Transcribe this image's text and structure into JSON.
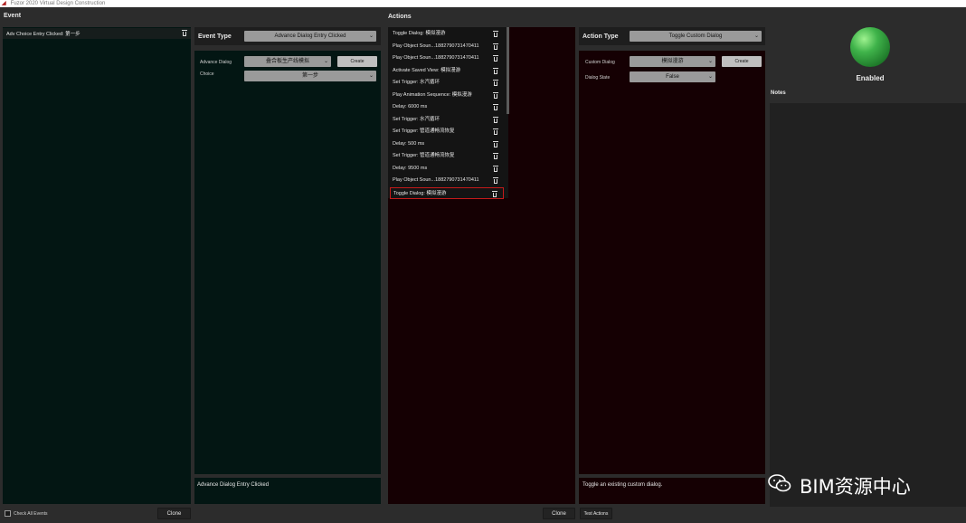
{
  "window": {
    "title": "Fuzor 2020 Virtual Design Construction"
  },
  "event": {
    "label": "Event",
    "entries": [
      "Adv Choice Entry Clicked: 第一步"
    ],
    "check_all_label": "Check All Events",
    "clone_label": "Clone"
  },
  "event_type": {
    "label": "Event Type",
    "value": "Advance Dialog Entry Clicked",
    "advance_dialog_label": "Advance Dialog",
    "advance_dialog_value": "叠合板生产线模拟",
    "choice_label": "Choice",
    "choice_value": "第一步",
    "create_label": "Create",
    "description": "Advance Dialog Entry Clicked"
  },
  "actions": {
    "label": "Actions",
    "items": [
      "Toggle Dialog: 模拟漫游",
      "Play Object Soun...1882790731470411",
      "Play Object Soun...1882790731470411",
      "Activate Saved View: 模拟漫游",
      "Set Trigger: 水汽循环",
      "Play Animation Sequence: 模拟漫游",
      "Delay: 6000 ms",
      "Set Trigger: 水汽循环",
      "Set Trigger: 管道通畅流恢复",
      "Delay: 500 ms",
      "Set Trigger: 管道通畅流恢复",
      "Delay: 9500 ms",
      "Play Object Soun...1882790731470411",
      "Toggle Dialog: 模拟漫游"
    ],
    "selected_index": 13,
    "clone_label": "Clone",
    "test_label": "Test Actions"
  },
  "action_type": {
    "label": "Action Type",
    "value": "Toggle Custom Dialog",
    "custom_dialog_label": "Custom Dialog",
    "custom_dialog_value": "模拟漫游",
    "dialog_state_label": "Dialog State",
    "dialog_state_value": "False",
    "create_label": "Create",
    "description": "Toggle an existing custom dialog."
  },
  "status": {
    "label": "Enabled",
    "color": "#2fa63a"
  },
  "notes": {
    "label": "Notes"
  },
  "watermark": {
    "text": "BIM资源中心"
  }
}
